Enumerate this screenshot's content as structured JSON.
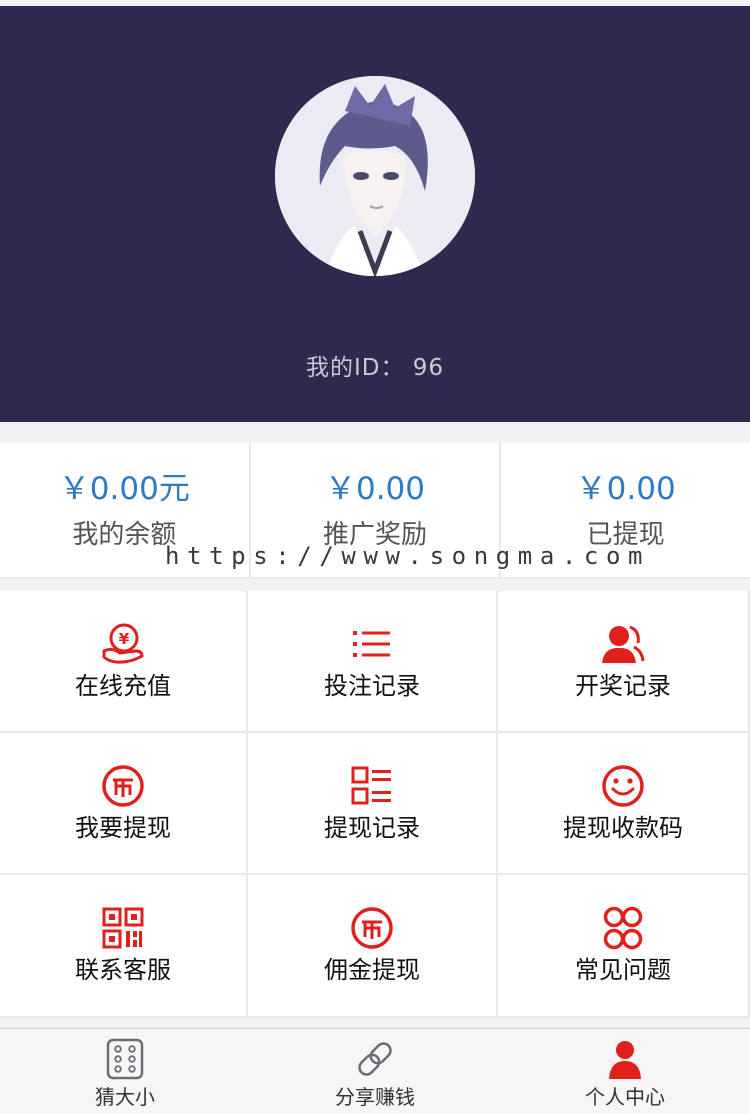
{
  "header": {
    "id_label": "我的ID： 96",
    "background_color": "#2f2a4d"
  },
  "stats": [
    {
      "value": "￥0.00元",
      "label": "我的余额"
    },
    {
      "value": "￥0.00",
      "label": "推广奖励"
    },
    {
      "value": "￥0.00",
      "label": "已提现"
    }
  ],
  "watermark": "https://www.songma.com",
  "menu": [
    {
      "label": "在线充值",
      "icon": "recharge-yen-icon"
    },
    {
      "label": "投注记录",
      "icon": "list-icon"
    },
    {
      "label": "开奖记录",
      "icon": "user-icon"
    },
    {
      "label": "我要提现",
      "icon": "coin-icon"
    },
    {
      "label": "提现记录",
      "icon": "record-list-icon"
    },
    {
      "label": "提现收款码",
      "icon": "smile-icon"
    },
    {
      "label": "联系客服",
      "icon": "qr-code-icon"
    },
    {
      "label": "佣金提现",
      "icon": "coin-icon"
    },
    {
      "label": "常见问题",
      "icon": "four-circles-icon"
    }
  ],
  "tabs": [
    {
      "label": "猜大小",
      "icon": "dice-icon",
      "active": false
    },
    {
      "label": "分享赚钱",
      "icon": "link-icon",
      "active": false
    },
    {
      "label": "个人中心",
      "icon": "person-icon",
      "active": true
    }
  ],
  "colors": {
    "accent_red": "#e0201b",
    "stat_blue": "#2f7bc2"
  }
}
